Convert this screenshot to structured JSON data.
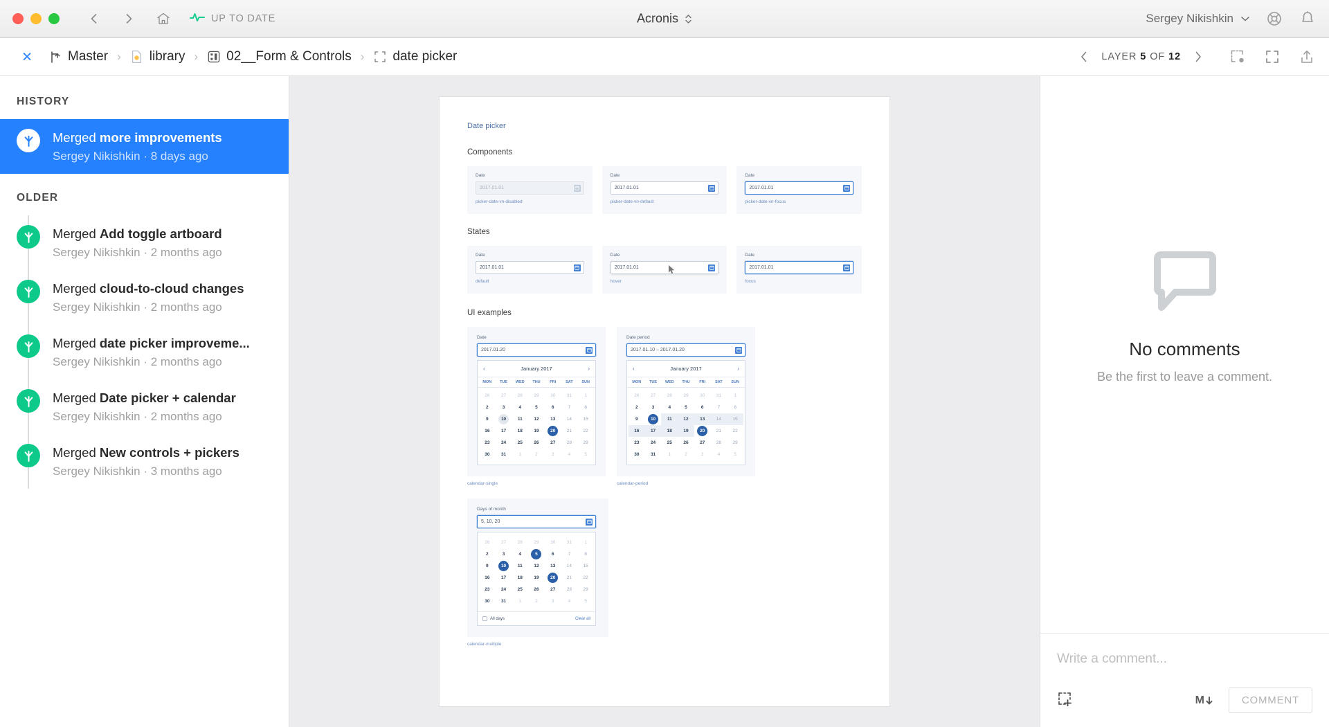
{
  "titlebar": {
    "status_label": "UP TO DATE",
    "app_title": "Acronis",
    "user_name": "Sergey Nikishkin",
    "icons": {
      "back": "chevron-left-icon",
      "forward": "chevron-right-icon",
      "home": "home-icon",
      "pulse": "pulse-icon",
      "help": "lifebuoy-icon",
      "bell": "bell-icon"
    }
  },
  "breadcrumb": {
    "close": "×",
    "items": [
      {
        "label": "Master",
        "icon": "branch-icon"
      },
      {
        "label": "library",
        "icon": "document-icon"
      },
      {
        "label": "02__Form & Controls",
        "icon": "page-grid-icon"
      },
      {
        "label": "date picker",
        "icon": "artboard-icon"
      }
    ],
    "separator": "›",
    "layer_prefix": "LAYER",
    "layer_current": "5",
    "layer_of": "OF",
    "layer_total": "12",
    "tools": [
      "comment-pin-icon",
      "fullscreen-icon",
      "share-icon"
    ]
  },
  "sidebar": {
    "history_title": "HISTORY",
    "older_title": "OLDER",
    "current": {
      "action": "Merged",
      "title": "more improvements",
      "meta": "Sergey Nikishkin · 8 days ago"
    },
    "older": [
      {
        "action": "Merged",
        "title": "Add toggle artboard",
        "meta": "Sergey Nikishkin · 2 months ago"
      },
      {
        "action": "Merged",
        "title": "cloud-to-cloud changes",
        "meta": "Sergey Nikishkin · 2 months ago"
      },
      {
        "action": "Merged",
        "title": "date picker improveme...",
        "meta": "Sergey Nikishkin · 2 months ago"
      },
      {
        "action": "Merged",
        "title": "Date picker + calendar",
        "meta": "Sergey Nikishkin · 2 months ago"
      },
      {
        "action": "Merged",
        "title": "New controls + pickers",
        "meta": "Sergey Nikishkin · 3 months ago"
      }
    ]
  },
  "artboard": {
    "title": "Date picker",
    "sections": {
      "components": "Components",
      "states": "States",
      "ui_examples": "UI examples"
    },
    "components": [
      {
        "label": "Date",
        "value": "2017.01.01",
        "caption": "picker-date-vn-disabled",
        "state": "disabled"
      },
      {
        "label": "Date",
        "value": "2017.01.01",
        "caption": "picker-date-vn-default",
        "state": "default"
      },
      {
        "label": "Date",
        "value": "2017.01.01",
        "caption": "picker-date-vn-focus",
        "state": "focus"
      }
    ],
    "states": [
      {
        "label": "Date",
        "value": "2017.01.01",
        "caption": "default",
        "state": "default"
      },
      {
        "label": "Date",
        "value": "2017.01.01",
        "caption": "hover",
        "state": "hover"
      },
      {
        "label": "Date",
        "value": "2017.01.01",
        "caption": "focus",
        "state": "focus"
      }
    ],
    "calendar_single": {
      "field_label": "Date",
      "field_value": "2017.01.20",
      "month": "January 2017",
      "prev": "‹",
      "next": "›",
      "dow": [
        "MON",
        "TUE",
        "WED",
        "THU",
        "FRI",
        "SAT",
        "SUN"
      ],
      "caption": "calendar-single",
      "selected": [
        20
      ],
      "hovered": [
        10
      ]
    },
    "calendar_period": {
      "field_label": "Date period",
      "field_value": "2017.01.10 – 2017.01.20",
      "month": "January 2017",
      "prev": "‹",
      "next": "›",
      "dow": [
        "MON",
        "TUE",
        "WED",
        "THU",
        "FRI",
        "SAT",
        "SUN"
      ],
      "caption": "calendar-period",
      "range_start": 10,
      "range_end": 20
    },
    "calendar_multiple": {
      "field_label": "Days of month",
      "field_value": "5, 10, 20",
      "caption": "calendar-multiple",
      "selected": [
        5,
        10,
        20
      ],
      "all_days_label": "All days",
      "clear_all_label": "Clear all"
    },
    "month_grid": [
      [
        {
          "d": 26,
          "m": true
        },
        {
          "d": 27,
          "m": true
        },
        {
          "d": 28,
          "m": true
        },
        {
          "d": 29,
          "m": true
        },
        {
          "d": 30,
          "m": true
        },
        {
          "d": 31,
          "m": true
        },
        {
          "d": 1,
          "m": true
        }
      ],
      [
        {
          "d": 2
        },
        {
          "d": 3
        },
        {
          "d": 4
        },
        {
          "d": 5
        },
        {
          "d": 6
        },
        {
          "d": 7,
          "dim": true
        },
        {
          "d": 8,
          "dim": true
        }
      ],
      [
        {
          "d": 9
        },
        {
          "d": 10
        },
        {
          "d": 11
        },
        {
          "d": 12
        },
        {
          "d": 13
        },
        {
          "d": 14,
          "dim": true
        },
        {
          "d": 15,
          "dim": true
        }
      ],
      [
        {
          "d": 16
        },
        {
          "d": 17
        },
        {
          "d": 18
        },
        {
          "d": 19
        },
        {
          "d": 20
        },
        {
          "d": 21,
          "dim": true
        },
        {
          "d": 22,
          "dim": true
        }
      ],
      [
        {
          "d": 23
        },
        {
          "d": 24
        },
        {
          "d": 25
        },
        {
          "d": 26
        },
        {
          "d": 27
        },
        {
          "d": 28,
          "dim": true
        },
        {
          "d": 29,
          "dim": true
        }
      ],
      [
        {
          "d": 30
        },
        {
          "d": 31
        },
        {
          "d": 1,
          "m": true
        },
        {
          "d": 2,
          "m": true
        },
        {
          "d": 3,
          "m": true
        },
        {
          "d": 4,
          "m": true
        },
        {
          "d": 5,
          "m": true
        }
      ]
    ]
  },
  "comments": {
    "empty_title": "No comments",
    "empty_sub": "Be the first to leave a comment.",
    "placeholder": "Write a comment...",
    "markdown_label": "M",
    "submit_label": "COMMENT",
    "attach_icon": "region-select-icon"
  },
  "colors": {
    "accent_blue": "#2681ff",
    "merge_green": "#0dc98a",
    "canvas_gray": "#ececee",
    "calendar_blue": "#2b5fa8"
  }
}
